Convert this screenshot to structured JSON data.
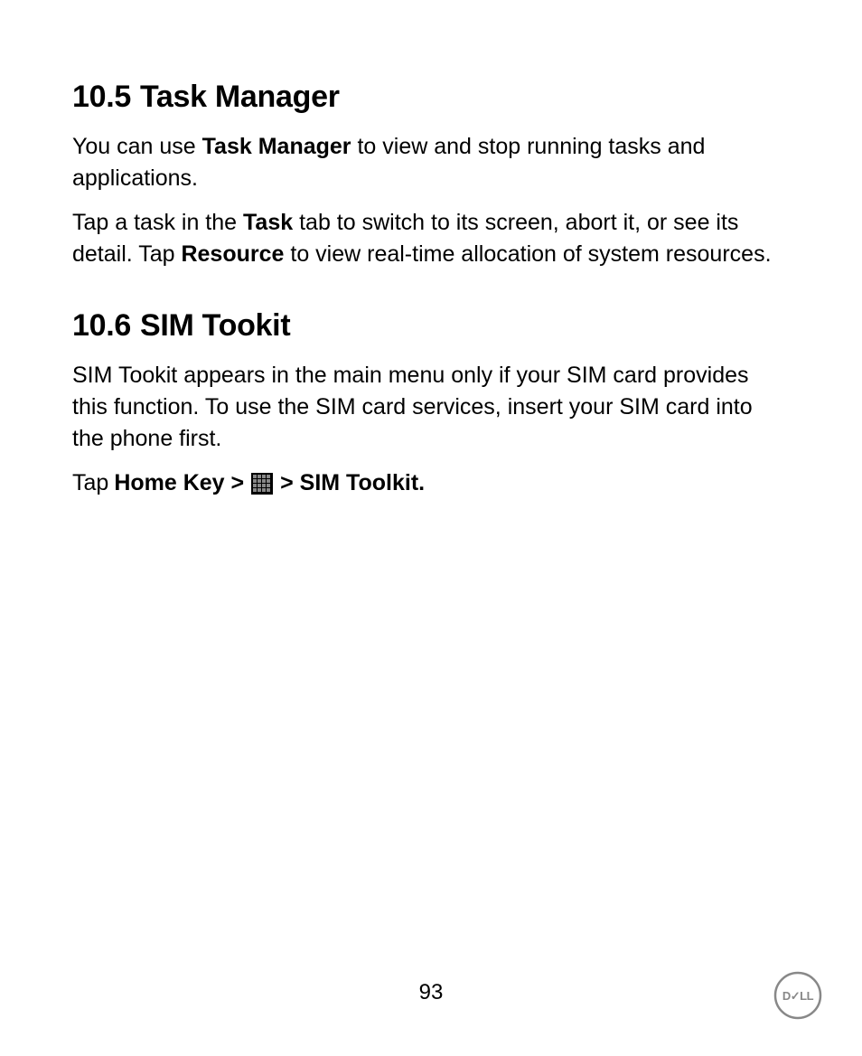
{
  "section1": {
    "number": "10.5",
    "title": "Task Manager",
    "para1_prefix": "You can use ",
    "para1_bold": "Task Manager",
    "para1_suffix": " to view and stop running tasks and applications.",
    "para2_prefix": "Tap a task in the ",
    "para2_bold1": "Task",
    "para2_mid": " tab to switch to its screen, abort it, or see its detail. Tap ",
    "para2_bold2": "Resource",
    "para2_suffix": " to view real-time allocation of system resources."
  },
  "section2": {
    "number": "10.6",
    "title": "SIM Tookit",
    "para1": "SIM Tookit appears in the main menu only if your SIM card provides this function. To use the SIM card services, insert your SIM card into the phone first.",
    "para2_prefix": "Tap ",
    "para2_bold1": "Home Key > ",
    "para2_bold2": " > SIM Toolkit."
  },
  "page_number": "93",
  "icons": {
    "apps_grid": "apps-grid-icon",
    "logo": "dell-logo"
  }
}
